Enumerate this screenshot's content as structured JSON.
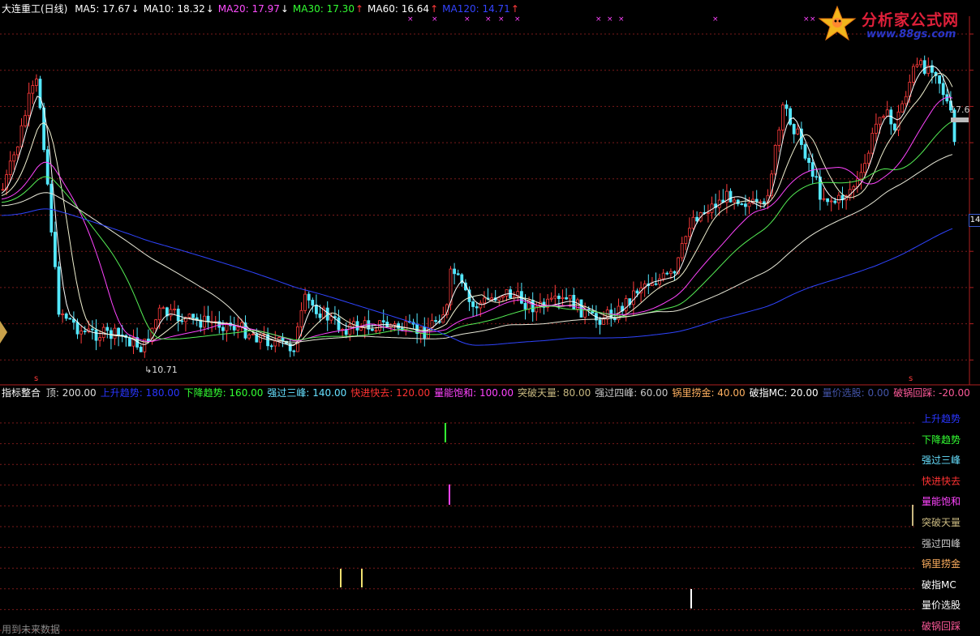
{
  "header": {
    "stock": "大连重工(日线)",
    "ma": [
      {
        "label": "MA5: 17.67",
        "arrow": "↓",
        "dir": "down",
        "color": "#ffffff"
      },
      {
        "label": "MA10: 18.32",
        "arrow": "↓",
        "dir": "down",
        "color": "#ffffff"
      },
      {
        "label": "MA20: 17.97",
        "arrow": "↓",
        "dir": "down",
        "color": "#ff4dff"
      },
      {
        "label": "MA30: 17.30",
        "arrow": "↑",
        "dir": "up",
        "color": "#33ff33"
      },
      {
        "label": "MA60: 16.64",
        "arrow": "↑",
        "dir": "up",
        "color": "#ffffff"
      },
      {
        "label": "MA120: 14.71",
        "arrow": "↑",
        "dir": "up",
        "color": "#3344ff"
      }
    ]
  },
  "logo": {
    "title": "分析家公式网",
    "url": "www.88gs.com"
  },
  "price_labels": {
    "last": "17.6",
    "right_box": "14",
    "low": "10.71"
  },
  "indicator_header": {
    "name": "指标整合",
    "items": [
      {
        "label": "顶: 200.00",
        "color": "#dddddd"
      },
      {
        "label": "上升趋势: 180.00",
        "color": "#2a36ff"
      },
      {
        "label": "下降趋势: 160.00",
        "color": "#33ff33"
      },
      {
        "label": "强过三峰: 140.00",
        "color": "#66e0ff"
      },
      {
        "label": "快进快去: 120.00",
        "color": "#ff3333"
      },
      {
        "label": "量能饱和: 100.00",
        "color": "#ff44ff"
      },
      {
        "label": "突破天量: 80.00",
        "color": "#c8b880"
      },
      {
        "label": "强过四峰: 60.00",
        "color": "#c8c8c8"
      },
      {
        "label": "锅里捞金: 40.00",
        "color": "#ffb060"
      },
      {
        "label": "破指MC: 20.00",
        "color": "#ffffff"
      },
      {
        "label": "量价选股: 0.00",
        "color": "#4455aa"
      },
      {
        "label": "破锅回踩: -20.00",
        "color": "#ff5a9a"
      }
    ]
  },
  "right_labels": [
    {
      "label": "上升趋势",
      "color": "#2a36ff"
    },
    {
      "label": "下降趋势",
      "color": "#33ff33"
    },
    {
      "label": "强过三峰",
      "color": "#66e0ff"
    },
    {
      "label": "快进快去",
      "color": "#ff3333"
    },
    {
      "label": "量能饱和",
      "color": "#ff44ff"
    },
    {
      "label": "突破天量",
      "color": "#c8b880"
    },
    {
      "label": "强过四峰",
      "color": "#c8c8c8"
    },
    {
      "label": "锅里捞金",
      "color": "#ffb060"
    },
    {
      "label": "破指MC",
      "color": "#ffffff"
    },
    {
      "label": "量价选股",
      "color": "#ffffff"
    },
    {
      "label": "破锅回踩",
      "color": "#ff5a9a"
    }
  ],
  "footer_note": "用到未来数据",
  "signals": [
    {
      "series": "下降趋势",
      "color": "#33ff33"
    },
    {
      "series": "量能饱和",
      "color": "#ff44ff"
    },
    {
      "series": "突破天量",
      "color": "#c8b880"
    },
    {
      "series": "锅里捞金",
      "color": "#f0e070"
    },
    {
      "series": "锅里捞金",
      "color": "#f0e070"
    },
    {
      "series": "量价选股",
      "color": "#ffffff"
    }
  ],
  "s_marks": [
    "s",
    "s"
  ]
}
